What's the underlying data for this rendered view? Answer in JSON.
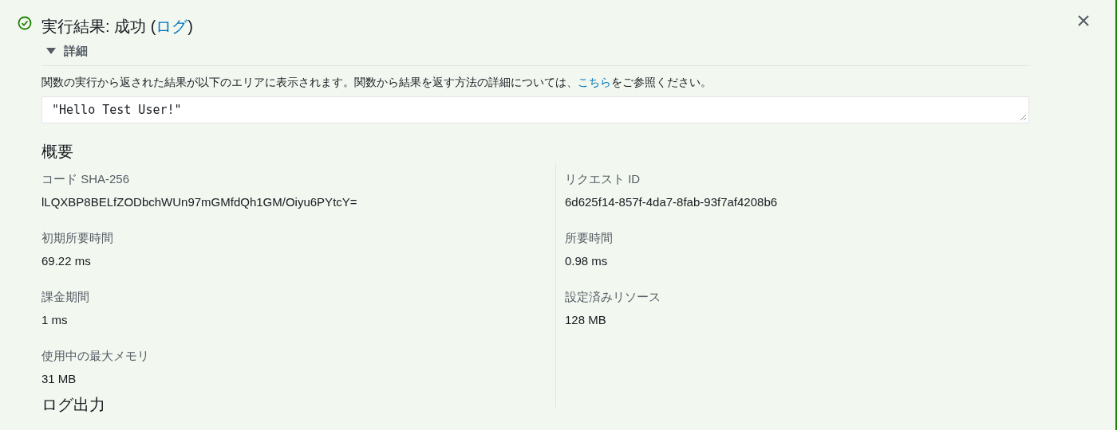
{
  "result": {
    "title": "実行結果: 成功 (",
    "link": "ログ",
    "title_end": ")"
  },
  "details": {
    "label": "詳細",
    "expanded": true,
    "description": {
      "before": "関数の実行から返された結果が以下のエリアに表示されます。関数から結果を返す方法の詳細については、",
      "link": "こちら",
      "after": "をご参照ください。"
    },
    "output": "\"Hello Test User!\""
  },
  "summary": {
    "title": "概要",
    "left": [
      {
        "label": "コード SHA-256",
        "value": "lLQXBP8BELfZODbchWUn97mGMfdQh1GM/Oiyu6PYtcY="
      },
      {
        "label": "初期所要時間",
        "value": "69.22 ms"
      },
      {
        "label": "課金期間",
        "value": "1 ms"
      },
      {
        "label": "使用中の最大メモリ",
        "value": "31 MB"
      }
    ],
    "right": [
      {
        "label": "リクエスト ID",
        "value": "6d625f14-857f-4da7-8fab-93f7af4208b6"
      },
      {
        "label": "所要時間",
        "value": "0.98 ms"
      },
      {
        "label": "設定済みリソース",
        "value": "128 MB"
      }
    ]
  },
  "log_output": {
    "title": "ログ出力"
  }
}
